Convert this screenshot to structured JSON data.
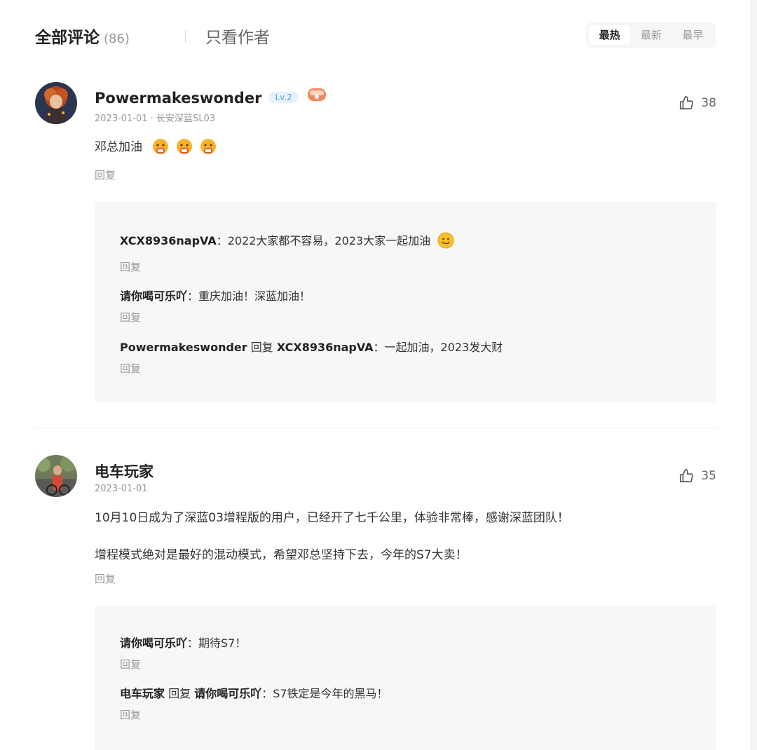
{
  "header": {
    "tab_all": "全部评论",
    "count": "(86)",
    "tab_author": "只看作者",
    "sort_options": [
      "最热",
      "最新",
      "最早"
    ]
  },
  "comments": [
    {
      "username": "Powermakeswonder",
      "level": "Lv.2",
      "date": "2023-01-01",
      "meta": "2023-01-01 · 长安深蓝SL03",
      "likes": "38",
      "content": [
        "邓总加油"
      ],
      "reply_label": "回复",
      "replies": [
        {
          "who": "XCX8936napVA",
          "to": "",
          "text": "：2022大家都不容易，2023大家一起加油",
          "reply_label": "回复"
        },
        {
          "who": "请你喝可乐吖",
          "to": "",
          "text": "：重庆加油！深蓝加油！",
          "reply_label": "回复"
        },
        {
          "who": "Powermakeswonder",
          "to_word": " 回复 ",
          "to": "XCX8936napVA",
          "text": "：一起加油，2023发大财",
          "reply_label": "回复"
        }
      ]
    },
    {
      "username": "电车玩家",
      "date": "2023-01-01",
      "likes": "35",
      "content": [
        "10月10日成为了深蓝03增程版的用户，已经开了七千公里，体验非常棒，感谢深蓝团队！",
        "增程模式绝对是最好的混动模式，希望邓总坚持下去，今年的S7大卖！"
      ],
      "reply_label": "回复",
      "replies": [
        {
          "who": "请你喝可乐吖",
          "to": "",
          "text": "：期待S7！",
          "reply_label": "回复"
        },
        {
          "who": "电车玩家",
          "to_word": " 回复 ",
          "to": "请你喝可乐吖",
          "text": "：S7铁定是今年的黑马！",
          "reply_label": "回复"
        }
      ]
    }
  ],
  "colors": {
    "accent_level": "#5b9cf0",
    "muted": "#999999",
    "reply_bg": "#f7f7f8"
  }
}
